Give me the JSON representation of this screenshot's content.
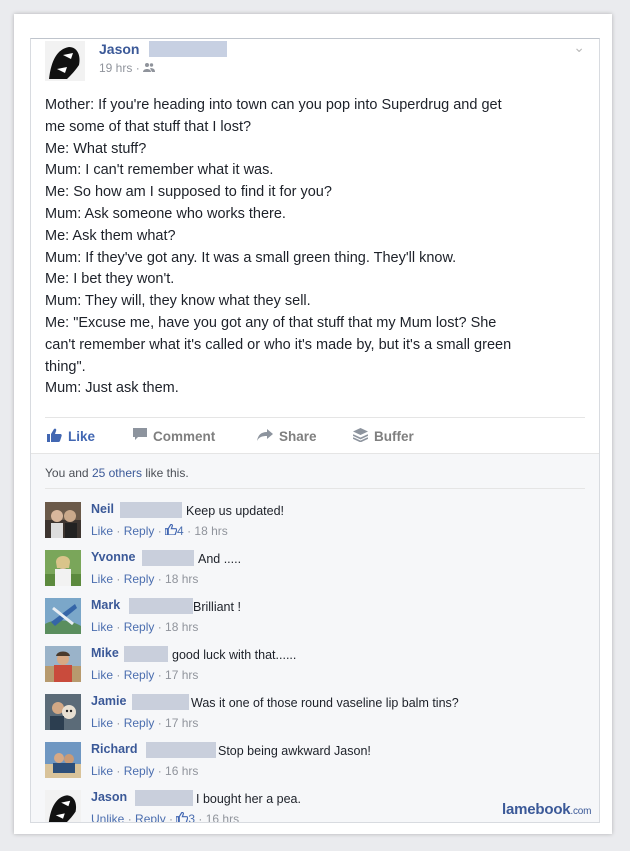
{
  "post": {
    "author": "Jason",
    "time": "19 hrs",
    "privacy_icon": "friends-icon",
    "lines": [
      "Mother: If you're heading into town can you pop into Superdrug and get",
      "me some of that stuff that I lost?",
      "Me: What stuff?",
      "Mum: I can't remember what it was.",
      "Me: So how am I supposed to find it for you?",
      "Mum: Ask someone who works there.",
      "Me: Ask them what?",
      "Mum: If they've got any. It was a small green thing. They'll know.",
      "Me: I bet they won't.",
      "Mum: They will, they know what they sell.",
      "Me: \"Excuse me, have you got any of that stuff that my Mum lost? She",
      "can't remember what it's called or who it's made by, but it's a small green",
      "thing\".",
      "Mum: Just ask them."
    ]
  },
  "actions": {
    "like": "Like",
    "comment": "Comment",
    "share": "Share",
    "buffer": "Buffer"
  },
  "likes_summary": {
    "prefix": "You and ",
    "link": "25 others",
    "suffix": " like this."
  },
  "comments": [
    {
      "name": "Neil",
      "text": "Keep us updated!",
      "like": "Like",
      "reply": "Reply",
      "likes_count": "4",
      "time": "18 hrs"
    },
    {
      "name": "Yvonne",
      "text": "And .....",
      "like": "Like",
      "reply": "Reply",
      "likes_count": "",
      "time": "18 hrs"
    },
    {
      "name": "Mark",
      "text": "Brilliant !",
      "like": "Like",
      "reply": "Reply",
      "likes_count": "",
      "time": "18 hrs"
    },
    {
      "name": "Mike",
      "text": "good luck with that......",
      "like": "Like",
      "reply": "Reply",
      "likes_count": "",
      "time": "17 hrs"
    },
    {
      "name": "Jamie",
      "text": "Was it one of those round vaseline lip balm tins?",
      "like": "Like",
      "reply": "Reply",
      "likes_count": "",
      "time": "17 hrs"
    },
    {
      "name": "Richard",
      "text": "Stop being awkward Jason!",
      "like": "Like",
      "reply": "Reply",
      "likes_count": "",
      "time": "16 hrs"
    },
    {
      "name": "Jason",
      "text": "I bought her a pea.",
      "like": "Unlike",
      "reply": "Reply",
      "likes_count": "3",
      "time": "16 hrs"
    }
  ],
  "watermark": {
    "main": "lamebook",
    "suffix": ".com"
  }
}
